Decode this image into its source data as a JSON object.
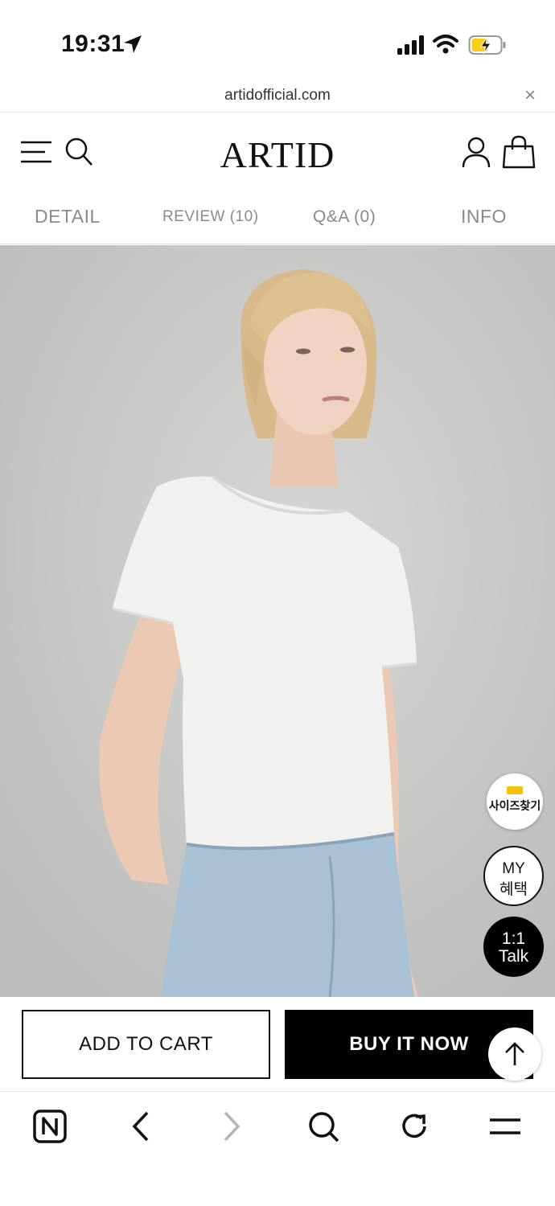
{
  "status_bar": {
    "time": "19:31",
    "icons": [
      "location-arrow-icon",
      "signal-icon",
      "wifi-icon",
      "battery-charging-icon"
    ]
  },
  "browser": {
    "url": "artidofficial.com",
    "close_label": "×"
  },
  "header": {
    "logo": "ARTID",
    "icons": [
      "menu-icon",
      "search-icon",
      "account-icon",
      "shopping-bag-icon"
    ]
  },
  "tabs": [
    {
      "label": "DETAIL"
    },
    {
      "label": "REVIEW (10)"
    },
    {
      "label": "Q&A (0)"
    },
    {
      "label": "INFO"
    }
  ],
  "floating": {
    "size_finder": "사이즈찾기",
    "my_line1": "MY",
    "my_line2": "혜택",
    "talk_line1": "1:1",
    "talk_line2": "Talk"
  },
  "actions": {
    "add_to_cart": "ADD TO CART",
    "buy_now": "BUY IT NOW"
  },
  "browser_nav": {
    "icons": [
      "naver-n-icon",
      "back-icon",
      "forward-icon",
      "find-icon",
      "reload-icon",
      "hamburger-menu-icon"
    ]
  },
  "colors": {
    "accent": "#000000",
    "photo_background": "#c9c9c7",
    "tab_text": "#8a8a8a",
    "size_finder_ruler": "#f5c400"
  }
}
